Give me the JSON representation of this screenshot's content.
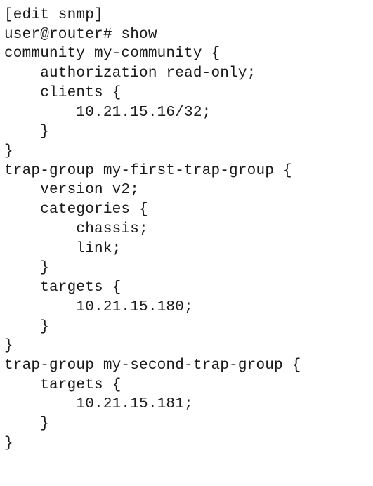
{
  "config": {
    "context": "[edit snmp]",
    "prompt": "user@router# show",
    "community_line": "community my-community {",
    "authorization_line": "    authorization read-only;",
    "clients_open": "    clients {",
    "client_ip": "        10.21.15.16/32;",
    "clients_close": "    }",
    "community_close": "}",
    "trap1_open": "trap-group my-first-trap-group {",
    "trap1_version": "    version v2;",
    "trap1_categories_open": "    categories {",
    "trap1_cat_chassis": "        chassis;",
    "trap1_cat_link": "        link;",
    "trap1_categories_close": "    }",
    "trap1_targets_open": "    targets {",
    "trap1_target_ip": "        10.21.15.180;",
    "trap1_targets_close": "    }",
    "trap1_close": "}",
    "trap2_open": "trap-group my-second-trap-group {",
    "trap2_targets_open": "    targets {",
    "trap2_target_ip": "        10.21.15.181;",
    "trap2_targets_close": "    }",
    "trap2_close": "}"
  }
}
